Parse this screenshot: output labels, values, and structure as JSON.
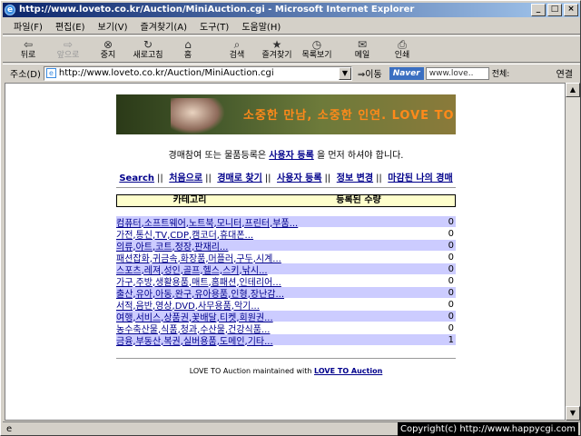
{
  "window": {
    "title": "http://www.loveto.co.kr/Auction/MiniAuction.cgi - Microsoft Internet Explorer"
  },
  "menu": [
    "파일(F)",
    "편집(E)",
    "보기(V)",
    "즐겨찾기(A)",
    "도구(T)",
    "도움말(H)"
  ],
  "toolbar": {
    "back": "뒤로",
    "forward": "앞으로",
    "stop": "중지",
    "refresh": "새로고침",
    "home": "홈",
    "search": "검색",
    "favorites": "즐겨찾기",
    "history": "목록보기",
    "mail": "메일",
    "print": "인쇄"
  },
  "address": {
    "label": "주소(D)",
    "url": "http://www.loveto.co.kr/Auction/MiniAuction.cgi",
    "go": "이동",
    "links": "연결"
  },
  "naver": {
    "logo": "Naver",
    "search_value": "www.love..",
    "all": "전체:"
  },
  "banner": {
    "text": "소중한 만남, 소중한 인연. LOVE TO"
  },
  "notice": {
    "pre": "경매참여 또는 물품등록은 ",
    "link": "사용자 등록",
    "post": " 을 먼저 하셔야 합니다."
  },
  "nav": [
    "Search",
    "처음으로",
    "경매로 찾기",
    "사용자 등록",
    "정보 변경",
    "마감된 나의 경매"
  ],
  "table": {
    "header_category": "카테고리",
    "header_count": "등록된 수량",
    "rows": [
      {
        "name": "컴퓨터,소프트웨어,노트북,모니터,프린터,부품...",
        "count": "0"
      },
      {
        "name": "가전,통신,TV,CDP,캠코더,휴대폰...",
        "count": "0"
      },
      {
        "name": "의류,아트,코트,정장,판재리...",
        "count": "0"
      },
      {
        "name": "패션잡화,귀금속,화장품,머플러,구두,시계...",
        "count": "0"
      },
      {
        "name": "스포츠,레져,성인,골프,헬스,스키,낚시...",
        "count": "0"
      },
      {
        "name": "가구,주방,생활용품,매트,홈패션,인테리어...",
        "count": "0"
      },
      {
        "name": "출산,유아,아동,완구,유아용품,인형,장난감...",
        "count": "0"
      },
      {
        "name": "서적,음반,영상,DVD,사무용품,악기...",
        "count": "0"
      },
      {
        "name": "여행,서비스,상품권,꽃배달,티켓,회원권...",
        "count": "0"
      },
      {
        "name": "농수축산물,식품,청과,수산물,건강식품...",
        "count": "0"
      },
      {
        "name": "금융,부동산,복권,실버용품,도메인,기타...",
        "count": "1"
      }
    ]
  },
  "footer": {
    "pre": "LOVE TO Auction maintained with ",
    "link": "LOVE TO Auction"
  },
  "status": {
    "copyright": "Copyright(c) http://www.happycgi.com"
  }
}
